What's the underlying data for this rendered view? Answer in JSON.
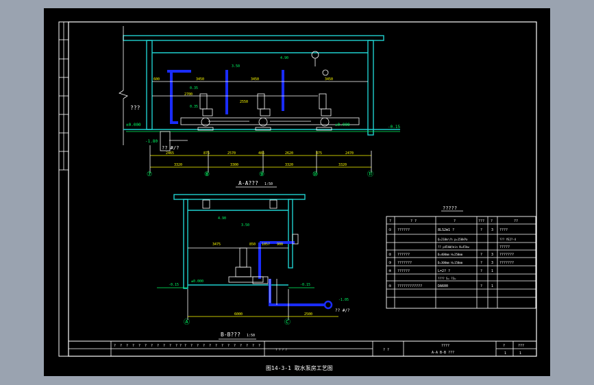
{
  "colors": {
    "background": "#000000",
    "frame": "#ffffff",
    "wall": "#1fd1cf",
    "pipe": "#1a2cff",
    "dim": "#ffff00",
    "level": "#00ff66"
  },
  "plan": {
    "room_label": "???",
    "elevations": {
      "floor_left": "±0.000",
      "floor_right": "±0.000",
      "outside_right": "-0.15",
      "pit": "-1.80",
      "tank": "?? #/?"
    },
    "top_dims": [
      "600",
      "3450",
      "3450",
      "3450"
    ],
    "mid_dims": [
      "2700",
      "2550"
    ],
    "elev_labels": [
      "3.50",
      "4.90",
      "0.35",
      "0.35"
    ],
    "bottom_dims_1": [
      "2465",
      "875",
      "2570",
      "485",
      "2620",
      "875",
      "2470"
    ],
    "bottom_dims_2": [
      "3320",
      "3300",
      "3320",
      "3320"
    ],
    "axes": [
      "⑦",
      "⑧",
      "⑨",
      "⑩",
      "⑪"
    ],
    "title": "A-A???",
    "scale": "1:50"
  },
  "section": {
    "top_elev": "4.90",
    "mid_elev": "3.50",
    "floor_elev": "±0.000",
    "left_elev": "-0.15",
    "right_elev": "-0.15",
    "pipe_elev": "-1.05",
    "tank": "?? #/?",
    "dims_row": [
      "3475",
      "850",
      "1057",
      "900"
    ],
    "bottom_dims": [
      "6000",
      "2500"
    ],
    "axes": [
      "Ⓐ",
      "Ⓒ"
    ],
    "title": "B-B???",
    "scale": "1:50"
  },
  "legend": {
    "title": "?????",
    "headers": [
      "?",
      "? ?",
      "?",
      "???",
      "?",
      "??"
    ],
    "rows": [
      {
        "no": "①",
        "name": "??????",
        "spec": "8LS2m1 ?",
        "unit": "?",
        "qty": "3",
        "note": "????"
      },
      {
        "no": "",
        "name": "",
        "spec": "Q=210m³/h  p=150kPa",
        "unit": "",
        "qty": "",
        "note": "???  YE2?-4"
      },
      {
        "no": "",
        "name": "",
        "spec": "?? p45kW/min  N=45kw",
        "unit": "",
        "qty": "",
        "note": "?????"
      },
      {
        "no": "②",
        "name": "??????",
        "spec": "D=400mm  H=250mm",
        "unit": "?",
        "qty": "3",
        "note": "???????"
      },
      {
        "no": "③",
        "name": "???????",
        "spec": "D=300mm  H=150mm",
        "unit": "?",
        "qty": "3",
        "note": "???????"
      },
      {
        "no": "④",
        "name": "??????",
        "spec": "L=2? ?",
        "unit": "?",
        "qty": "1",
        "note": ""
      },
      {
        "no": "",
        "name": "",
        "spec": "????  S=   ?3=",
        "unit": "",
        "qty": "",
        "note": ""
      },
      {
        "no": "⑤",
        "name": "????????????",
        "spec": "DA600",
        "unit": "?",
        "qty": "1",
        "note": ""
      }
    ]
  },
  "titleblock": {
    "left_cells": [
      "?",
      "?",
      "?",
      "?",
      "?",
      "?",
      "?",
      "?",
      "?",
      "?",
      "? ?",
      "?",
      "?",
      "?",
      "?",
      "?",
      "?",
      "?",
      "?",
      "?",
      "?",
      "?",
      "?",
      "?"
    ],
    "design": "? ? ? ?",
    "drawn": "? ?",
    "project": "????",
    "drawing_name": "A-A   B-B ???",
    "sheet_a": "?",
    "sheet_b": "1",
    "sheet_c": "???",
    "sheet_d": "?",
    "sheet_e": "1"
  },
  "caption": "图14-3-1  取水泵房工艺图"
}
